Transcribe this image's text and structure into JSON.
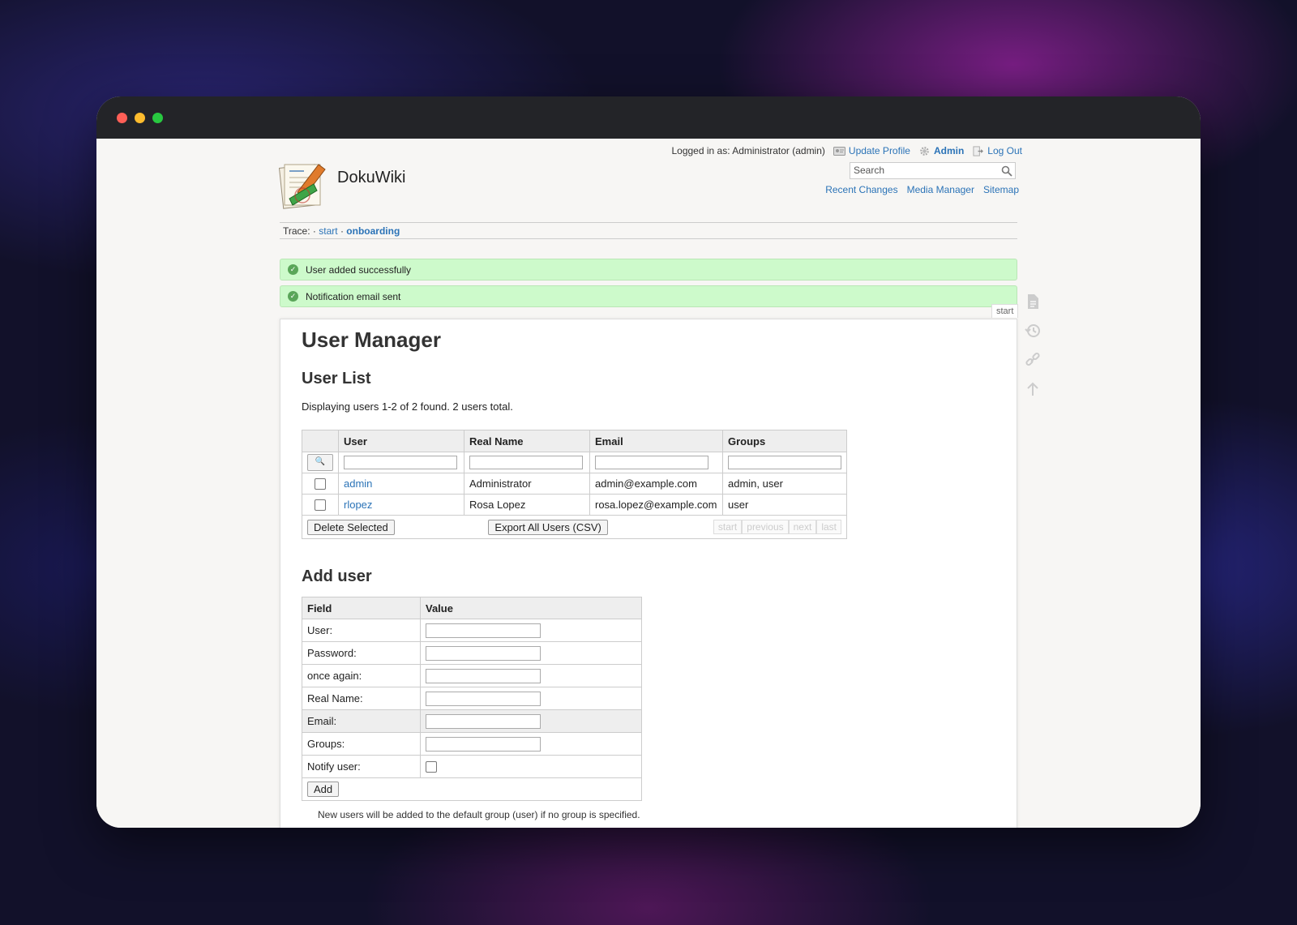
{
  "header": {
    "logged_in_text": "Logged in as: Administrator (admin)",
    "update_profile": "Update Profile",
    "admin": "Admin",
    "logout": "Log Out",
    "site_title": "DokuWiki",
    "search_placeholder": "Search",
    "sitetools": [
      "Recent Changes",
      "Media Manager",
      "Sitemap"
    ]
  },
  "breadcrumbs": {
    "label": "Trace:",
    "sep": "·",
    "items": [
      "start",
      "onboarding"
    ]
  },
  "messages": [
    "User added successfully",
    "Notification email sent"
  ],
  "page_tab": "start",
  "page": {
    "title": "User Manager",
    "list_heading": "User List",
    "info": "Displaying users 1-2 of 2 found. 2 users total.",
    "columns": [
      "User",
      "Real Name",
      "Email",
      "Groups"
    ],
    "users": [
      {
        "user": "admin",
        "name": "Administrator",
        "email": "admin@example.com",
        "groups": "admin, user"
      },
      {
        "user": "rlopez",
        "name": "Rosa Lopez",
        "email": "rosa.lopez@example.com",
        "groups": "user"
      }
    ],
    "delete_selected": "Delete Selected",
    "export": "Export All Users (CSV)",
    "pager": [
      "start",
      "previous",
      "next",
      "last"
    ],
    "add_heading": "Add user",
    "add_columns": [
      "Field",
      "Value"
    ],
    "add_fields": [
      "User:",
      "Password:",
      "once again:",
      "Real Name:",
      "Email:",
      "Groups:",
      "Notify user:"
    ],
    "add_button": "Add",
    "note": "New users will be added to the default group (user) if no group is specified."
  },
  "icons": {
    "update_profile": "profile-card-icon",
    "admin": "gear-icon",
    "logout": "logout-icon",
    "search": "search-icon",
    "filter": "magnifier-icon",
    "pagetools": [
      "page-icon",
      "history-icon",
      "link-icon",
      "arrow-up-icon"
    ]
  },
  "colors": {
    "link": "#2b73b7",
    "success_bg": "#cdfacb",
    "titlebar": "#232428"
  }
}
